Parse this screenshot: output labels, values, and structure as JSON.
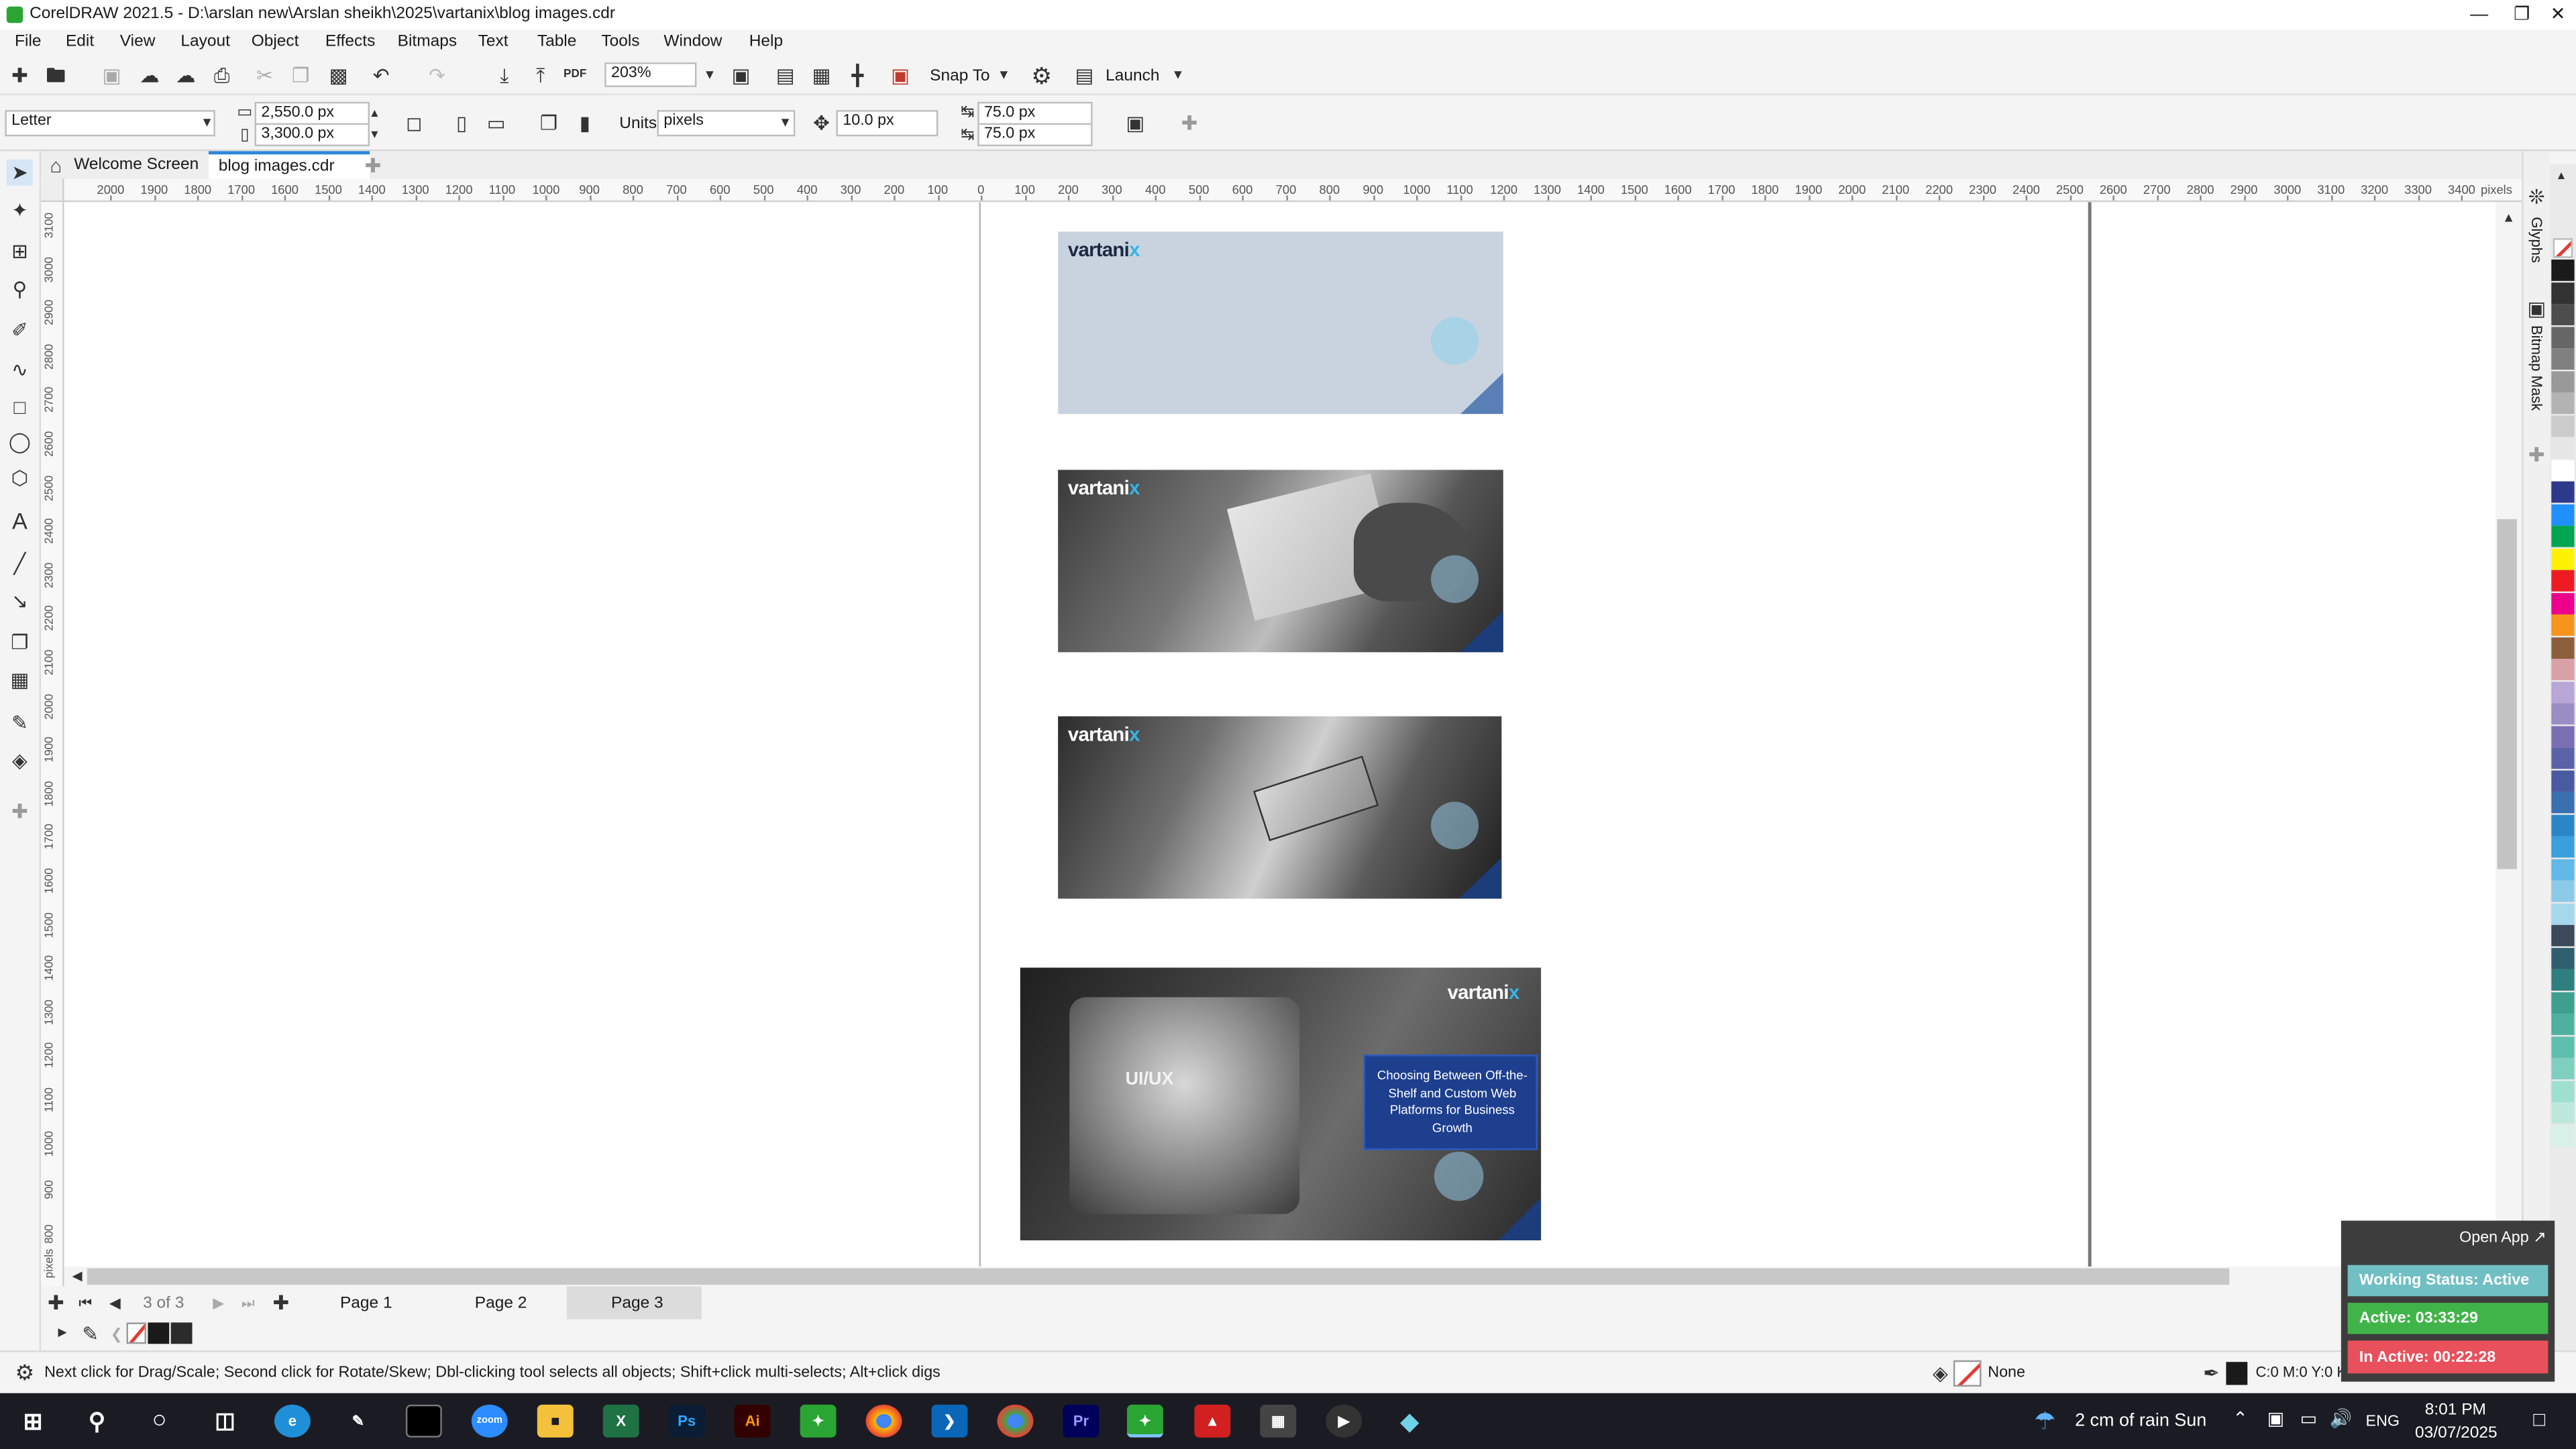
{
  "window": {
    "title": "CorelDRAW 2021.5 - D:\\arslan new\\Arslan sheikh\\2025\\vartanix\\blog images.cdr"
  },
  "menu": [
    "File",
    "Edit",
    "View",
    "Layout",
    "Object",
    "Effects",
    "Bitmaps",
    "Text",
    "Table",
    "Tools",
    "Window",
    "Help"
  ],
  "toolbar": {
    "zoom": "203%",
    "snap": "Snap To",
    "launch": "Launch",
    "pdf_label": "PDF"
  },
  "props": {
    "page_size": "Letter",
    "width": "2,550.0 px",
    "height": "3,300.0 px",
    "units_label": "Units:",
    "units": "pixels",
    "nudge": "10.0 px",
    "dup_x": "75.0 px",
    "dup_y": "75.0 px"
  },
  "tabs": [
    "Welcome Screen",
    "blog images.cdr"
  ],
  "ruler": {
    "h_ticks": [
      "2000",
      "1900",
      "1800",
      "1700",
      "1600",
      "1500",
      "1400",
      "1300",
      "1200",
      "1100",
      "1000",
      "900",
      "800",
      "700",
      "600",
      "500",
      "400",
      "300",
      "200",
      "100",
      "0",
      "100",
      "200",
      "300",
      "400",
      "500",
      "600",
      "700",
      "800",
      "900",
      "1000",
      "1100",
      "1200",
      "1300",
      "1400",
      "1500",
      "1600",
      "1700",
      "1800",
      "1900",
      "2000",
      "2100",
      "2200",
      "2300",
      "2400",
      "2500",
      "2600",
      "2700",
      "2800",
      "2900",
      "3000",
      "3100",
      "3200",
      "3300",
      "3400"
    ],
    "unit": "pixels",
    "v_ticks": [
      "3100",
      "3000",
      "2900",
      "2800",
      "2700",
      "2600",
      "2500",
      "2400",
      "2300",
      "2200",
      "2100",
      "2000",
      "1900",
      "1800",
      "1700",
      "1600",
      "1500",
      "1400",
      "1300",
      "1200",
      "1100",
      "1000",
      "900",
      "800"
    ],
    "v_unit": "pixels"
  },
  "cards": {
    "logo_main": "vartani",
    "logo_x": "x",
    "uiux": "UI/UX",
    "headline": "Choosing Between Off-the-Shelf and Custom Web Platforms for Business Growth"
  },
  "dockers": [
    "Glyphs",
    "Bitmap Mask"
  ],
  "pages": {
    "count": "3 of 3",
    "tabs": [
      "Page 1",
      "Page 2",
      "Page 3"
    ],
    "active": "Page 3"
  },
  "status": {
    "hint": "Next click for Drag/Scale; Second click for Rotate/Skew; Dbl-clicking tool selects all objects; Shift+click multi-selects; Alt+click digs",
    "fill": "None",
    "outline": "C:0 M:0 Y:0 K:100  0.500 pt"
  },
  "tracker": {
    "open": "Open App ↗",
    "working": "Working Status: Active",
    "active": "Active: 03:33:29",
    "inactive": "In Active: 00:22:28"
  },
  "taskbar": {
    "weather": "2 cm of rain Sun",
    "lang": "ENG",
    "time": "8:01 PM",
    "date": "03/07/2025"
  },
  "palette_colors": [
    "#1a1a1a",
    "#333333",
    "#4d4d4d",
    "#666666",
    "#808080",
    "#999999",
    "#b3b3b3",
    "#cccccc",
    "#e6e6e6",
    "#ffffff",
    "#2d3a8c",
    "#1e90ff",
    "#00a651",
    "#fff200",
    "#ed1c24",
    "#ec008c",
    "#f7941d",
    "#8b5e3c",
    "#d9a0a8",
    "#b7a6d6",
    "#9b8ec4",
    "#7b6fb4",
    "#5a63a8",
    "#4a5aa0",
    "#3a6fb0",
    "#2b86c8",
    "#3aa0dc",
    "#62b8e6",
    "#8ccbe8",
    "#a6d8ec",
    "#3a4a5a",
    "#2f5f6f",
    "#2f7f7f",
    "#3f9f8f",
    "#4fb09f",
    "#5fbfaf",
    "#7fcfbf",
    "#9fdfcf",
    "#bfe8dc",
    "#d8f0e8"
  ]
}
